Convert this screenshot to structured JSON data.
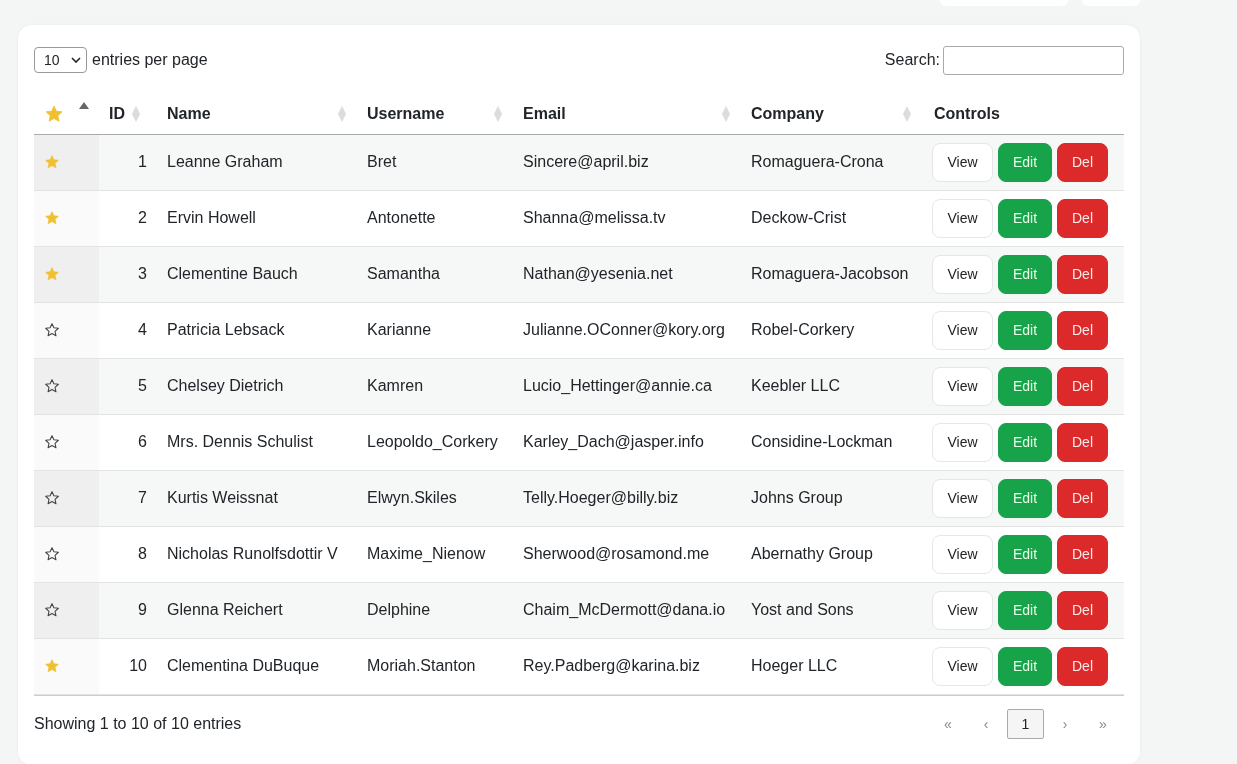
{
  "length_menu": {
    "value": "10",
    "label": "entries per page"
  },
  "search": {
    "label": "Search:"
  },
  "table": {
    "columns": [
      {
        "kind": "star",
        "sorted": true
      },
      {
        "label": "ID",
        "sorted": false
      },
      {
        "label": "Name",
        "sorted": false
      },
      {
        "label": "Username",
        "sorted": false
      },
      {
        "label": "Email",
        "sorted": false
      },
      {
        "label": "Company",
        "sorted": false
      },
      {
        "label": "Controls"
      }
    ],
    "rows": [
      {
        "starred": true,
        "id": "1",
        "name": "Leanne Graham",
        "username": "Bret",
        "email": "Sincere@april.biz",
        "company": "Romaguera-Crona",
        "buttons": [
          {
            "label": "View",
            "kind": "view"
          },
          {
            "label": "Edit",
            "kind": "edit"
          },
          {
            "label": "Del",
            "kind": "delete"
          }
        ]
      },
      {
        "starred": true,
        "id": "2",
        "name": "Ervin Howell",
        "username": "Antonette",
        "email": "Shanna@melissa.tv",
        "company": "Deckow-Crist",
        "buttons": [
          {
            "label": "View",
            "kind": "view"
          },
          {
            "label": "Edit",
            "kind": "edit"
          },
          {
            "label": "Del",
            "kind": "delete"
          }
        ]
      },
      {
        "starred": true,
        "id": "3",
        "name": "Clementine Bauch",
        "username": "Samantha",
        "email": "Nathan@yesenia.net",
        "company": "Romaguera-Jacobson",
        "buttons": [
          {
            "label": "View",
            "kind": "view"
          },
          {
            "label": "Edit",
            "kind": "edit"
          },
          {
            "label": "Del",
            "kind": "delete"
          }
        ]
      },
      {
        "starred": false,
        "id": "4",
        "name": "Patricia Lebsack",
        "username": "Karianne",
        "email": "Julianne.OConner@kory.org",
        "company": "Robel-Corkery",
        "buttons": [
          {
            "label": "View",
            "kind": "view"
          },
          {
            "label": "Edit",
            "kind": "edit"
          },
          {
            "label": "Del",
            "kind": "delete"
          }
        ]
      },
      {
        "starred": false,
        "id": "5",
        "name": "Chelsey Dietrich",
        "username": "Kamren",
        "email": "Lucio_Hettinger@annie.ca",
        "company": "Keebler LLC",
        "buttons": [
          {
            "label": "View",
            "kind": "view"
          },
          {
            "label": "Edit",
            "kind": "edit"
          },
          {
            "label": "Del",
            "kind": "delete"
          }
        ]
      },
      {
        "starred": false,
        "id": "6",
        "name": "Mrs. Dennis Schulist",
        "username": "Leopoldo_Corkery",
        "email": "Karley_Dach@jasper.info",
        "company": "Considine-Lockman",
        "buttons": [
          {
            "label": "View",
            "kind": "view"
          },
          {
            "label": "Edit",
            "kind": "edit"
          },
          {
            "label": "Del",
            "kind": "delete"
          }
        ]
      },
      {
        "starred": false,
        "id": "7",
        "name": "Kurtis Weissnat",
        "username": "Elwyn.Skiles",
        "email": "Telly.Hoeger@billy.biz",
        "company": "Johns Group",
        "buttons": [
          {
            "label": "View",
            "kind": "view"
          },
          {
            "label": "Edit",
            "kind": "edit"
          },
          {
            "label": "Del",
            "kind": "delete"
          }
        ]
      },
      {
        "starred": false,
        "id": "8",
        "name": "Nicholas Runolfsdottir V",
        "username": "Maxime_Nienow",
        "email": "Sherwood@rosamond.me",
        "company": "Abernathy Group",
        "buttons": [
          {
            "label": "View",
            "kind": "view"
          },
          {
            "label": "Edit",
            "kind": "edit"
          },
          {
            "label": "Del",
            "kind": "delete"
          }
        ]
      },
      {
        "starred": false,
        "id": "9",
        "name": "Glenna Reichert",
        "username": "Delphine",
        "email": "Chaim_McDermott@dana.io",
        "company": "Yost and Sons",
        "buttons": [
          {
            "label": "View",
            "kind": "view"
          },
          {
            "label": "Edit",
            "kind": "edit"
          },
          {
            "label": "Del",
            "kind": "delete"
          }
        ]
      },
      {
        "starred": true,
        "id": "10",
        "name": "Clementina DuBuque",
        "username": "Moriah.Stanton",
        "email": "Rey.Padberg@karina.biz",
        "company": "Hoeger LLC",
        "buttons": [
          {
            "label": "View",
            "kind": "view"
          },
          {
            "label": "Edit",
            "kind": "edit"
          },
          {
            "label": "Del",
            "kind": "delete"
          }
        ]
      }
    ]
  },
  "info": "Showing 1 to 10 of 10 entries",
  "pagination": [
    {
      "label": "«",
      "selected": false
    },
    {
      "label": "‹",
      "selected": false
    },
    {
      "label": "1",
      "selected": true
    },
    {
      "label": "›",
      "selected": false
    },
    {
      "label": "»",
      "selected": false
    }
  ]
}
